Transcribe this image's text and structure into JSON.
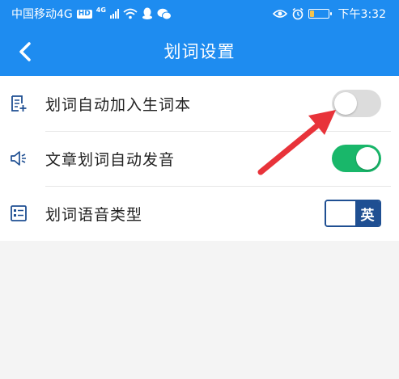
{
  "status_bar": {
    "carrier": "中国移动4G",
    "hd_badge": "HD",
    "network_sup": "4G",
    "time": "下午3:32"
  },
  "header": {
    "title": "划词设置"
  },
  "settings": [
    {
      "label": "划词自动加入生词本",
      "control": "toggle",
      "state": "off"
    },
    {
      "label": "文章划词自动发音",
      "control": "toggle",
      "state": "on"
    },
    {
      "label": "划词语音类型",
      "control": "segment",
      "value": "英"
    }
  ],
  "colors": {
    "brand_blue": "#1e8cf0",
    "toggle_on": "#19b76a",
    "toggle_off": "#dcdcdc",
    "segment_navy": "#1f4f92",
    "annotation_arrow": "#e8333a"
  },
  "icons": {
    "row_0": "document-add-icon",
    "row_1": "speaker-icon",
    "row_2": "voice-type-icon"
  }
}
